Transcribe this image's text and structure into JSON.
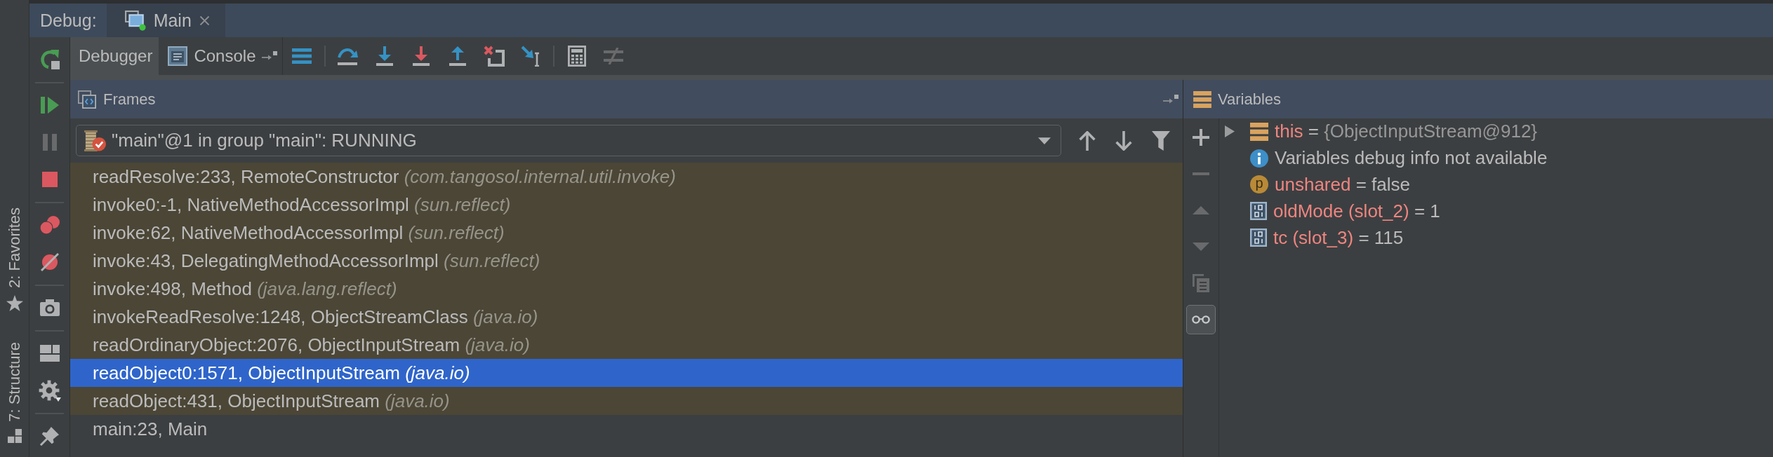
{
  "tool_window": {
    "title": "Debug:",
    "tabs": [
      {
        "label": "Main",
        "selected": true,
        "running": true
      }
    ]
  },
  "left_stripe": [
    {
      "kind": "favorites",
      "label": "2: Favorites"
    },
    {
      "kind": "structure",
      "label": "7: Structure"
    }
  ],
  "debug_actions": [
    [
      {
        "kind": "rerun",
        "disabled": false
      }
    ],
    [
      {
        "kind": "resume",
        "disabled": false
      },
      {
        "kind": "pause",
        "disabled": true
      },
      {
        "kind": "stop",
        "disabled": false
      }
    ],
    [
      {
        "kind": "breakpoints",
        "disabled": false
      },
      {
        "kind": "mute",
        "disabled": false
      }
    ],
    [
      {
        "kind": "snapshot",
        "disabled": false
      }
    ],
    [
      {
        "kind": "layout",
        "disabled": false
      },
      {
        "kind": "settings",
        "disabled": false
      }
    ],
    [
      {
        "kind": "pin",
        "disabled": false
      }
    ]
  ],
  "toolbar": {
    "tabs": [
      {
        "kind": "debugger",
        "label": "Debugger",
        "selected": true
      },
      {
        "kind": "console",
        "label": "Console",
        "selected": false
      }
    ],
    "actions": [
      [
        {
          "kind": "threads",
          "disabled": false
        }
      ],
      [
        {
          "kind": "step_over",
          "disabled": false
        },
        {
          "kind": "step_into",
          "disabled": false
        },
        {
          "kind": "force_step_into",
          "disabled": false
        },
        {
          "kind": "step_out",
          "disabled": false
        },
        {
          "kind": "drop_frame",
          "disabled": false
        },
        {
          "kind": "run_to_cursor",
          "disabled": false
        }
      ],
      [
        {
          "kind": "evaluate",
          "disabled": false
        },
        {
          "kind": "trace",
          "disabled": true
        }
      ]
    ]
  },
  "frames": {
    "title": "Frames",
    "thread": "\"main\"@1 in group \"main\": RUNNING",
    "items": [
      {
        "text": "readResolve:233, RemoteConstructor *(com.tangosol.internal.util.invoke)*",
        "library": true,
        "selected": false
      },
      {
        "text": "invoke0:-1, NativeMethodAccessorImpl *(sun.reflect)*",
        "library": true,
        "selected": false
      },
      {
        "text": "invoke:62, NativeMethodAccessorImpl *(sun.reflect)*",
        "library": true,
        "selected": false
      },
      {
        "text": "invoke:43, DelegatingMethodAccessorImpl *(sun.reflect)*",
        "library": true,
        "selected": false
      },
      {
        "text": "invoke:498, Method *(java.lang.reflect)*",
        "library": true,
        "selected": false
      },
      {
        "text": "invokeReadResolve:1248, ObjectStreamClass *(java.io)*",
        "library": true,
        "selected": false
      },
      {
        "text": "readOrdinaryObject:2076, ObjectInputStream *(java.io)*",
        "library": true,
        "selected": false
      },
      {
        "text": "readObject0:1571, ObjectInputStream *(java.io)*",
        "library": true,
        "selected": true
      },
      {
        "text": "readObject:431, ObjectInputStream *(java.io)*",
        "library": true,
        "selected": false
      },
      {
        "text": "main:23, Main",
        "library": false,
        "selected": false
      }
    ]
  },
  "variables": {
    "title": "Variables",
    "actions": [
      {
        "kind": "add",
        "disabled": false,
        "on": false
      },
      {
        "kind": "remove",
        "disabled": true,
        "on": false
      },
      {
        "kind": "up",
        "disabled": true,
        "on": false
      },
      {
        "kind": "down",
        "disabled": true,
        "on": false
      },
      {
        "kind": "copy",
        "disabled": true,
        "on": false
      },
      {
        "kind": "inline",
        "disabled": false,
        "on": true
      }
    ],
    "items": [
      {
        "kind": "object",
        "name": "this",
        "sign": "=",
        "value": "{ObjectInputStream@912}",
        "expanded": false
      },
      {
        "kind": "info",
        "text": "Variables debug info not available"
      },
      {
        "kind": "param",
        "badge": "p",
        "name": "unshared",
        "sign": "=",
        "value": "false"
      },
      {
        "kind": "local",
        "name": "oldMode (slot_2)",
        "sign": "=",
        "value": "1"
      },
      {
        "kind": "local",
        "name": "tc (slot_3)",
        "sign": "=",
        "value": "115"
      }
    ]
  }
}
